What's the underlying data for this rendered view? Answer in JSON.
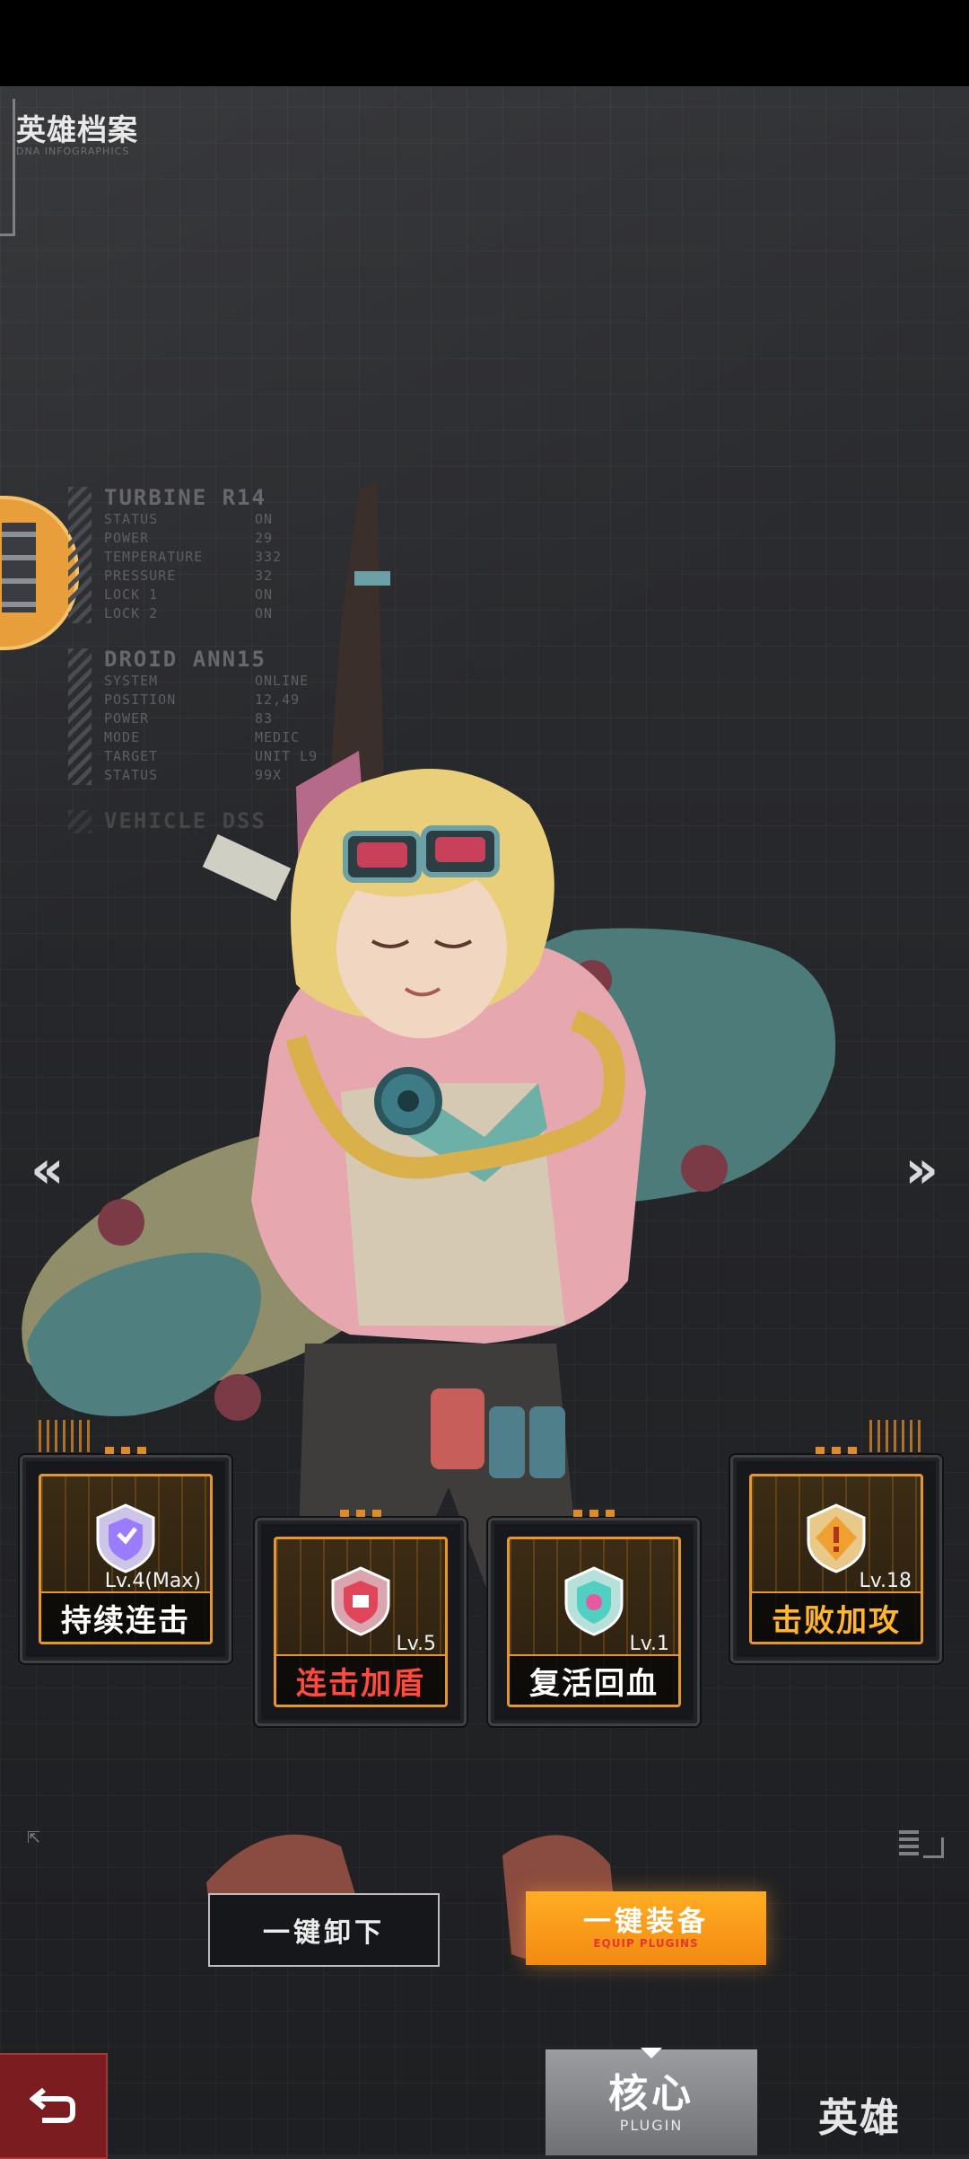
{
  "header": {
    "title": "英雄档案",
    "subtitle": "DNA INFOGRAPHICS"
  },
  "hud": {
    "blocks": [
      {
        "head": "TURBINE R14",
        "rows": [
          {
            "k": "STATUS",
            "v": "ON"
          },
          {
            "k": "POWER",
            "v": "29"
          },
          {
            "k": "TEMPERATURE",
            "v": "332"
          },
          {
            "k": "PRESSURE",
            "v": "32"
          },
          {
            "k": "LOCK 1",
            "v": "ON"
          },
          {
            "k": "LOCK 2",
            "v": "ON"
          }
        ]
      },
      {
        "head": "DROID ANN15",
        "rows": [
          {
            "k": "SYSTEM",
            "v": "ONLINE"
          },
          {
            "k": "POSITION",
            "v": "12,49"
          },
          {
            "k": "POWER",
            "v": "83"
          },
          {
            "k": "MODE",
            "v": "MEDIC"
          },
          {
            "k": "TARGET",
            "v": "UNIT L9"
          },
          {
            "k": "STATUS",
            "v": "99X"
          }
        ]
      },
      {
        "head": "VEHICLE DSS",
        "rows": []
      }
    ]
  },
  "nav": {
    "prev": "«",
    "next": "»"
  },
  "plugins": [
    {
      "name": "持续连击",
      "level": "Lv.4(Max)",
      "name_color": "#ffffff",
      "emblem_color": "#9b7bff"
    },
    {
      "name": "连击加盾",
      "level": "Lv.5",
      "name_color": "#ff4a3d",
      "emblem_color": "#e0455a"
    },
    {
      "name": "复活回血",
      "level": "Lv.1",
      "name_color": "#ffffff",
      "emblem_color": "#4fd0c0"
    },
    {
      "name": "击败加攻",
      "level": "Lv.18",
      "name_color": "#ffb52e",
      "emblem_color": "#f0a030"
    }
  ],
  "actions": {
    "unequip_label": "一键卸下",
    "equip_label": "一键装备",
    "equip_sub": "EQUIP PLUGINS"
  },
  "bottom_nav": {
    "back_icon": "back-arrow-icon",
    "core_label": "核心",
    "core_sub": "PLUGIN",
    "hero_label": "英雄"
  },
  "colors": {
    "accent_orange": "#f7a21c",
    "panel_orange": "#e6962e",
    "back_red": "#7b1c20"
  }
}
